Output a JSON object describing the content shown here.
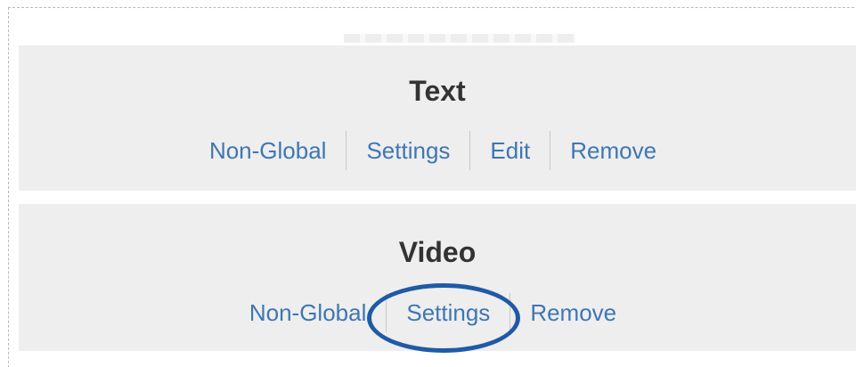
{
  "blocks": [
    {
      "title": "Text",
      "actions": [
        "Non-Global",
        "Settings",
        "Edit",
        "Remove"
      ]
    },
    {
      "title": "Video",
      "actions": [
        "Non-Global",
        "Settings",
        "Remove"
      ]
    }
  ],
  "colors": {
    "link": "#3f76b3",
    "highlight": "#1f5aa6",
    "block_bg": "#eeeeee",
    "title": "#333333"
  }
}
